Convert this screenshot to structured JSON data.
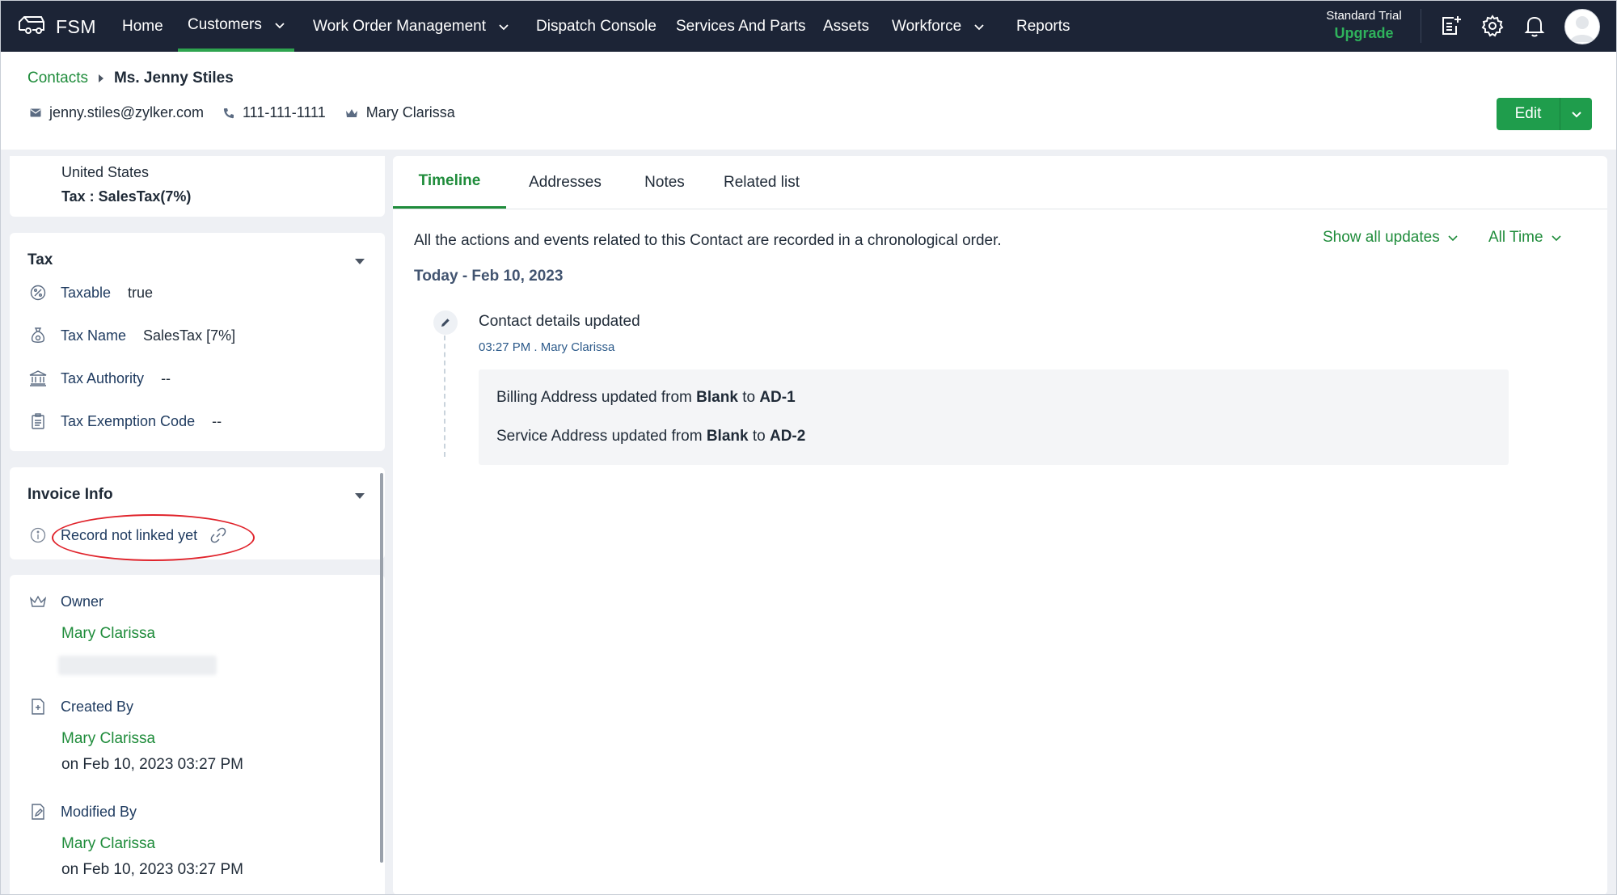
{
  "app": {
    "brand": "FSM",
    "nav": [
      {
        "label": "Home"
      },
      {
        "label": "Customers"
      },
      {
        "label": "Work Order Management"
      },
      {
        "label": "Dispatch Console"
      },
      {
        "label": "Services And Parts"
      },
      {
        "label": "Assets"
      },
      {
        "label": "Workforce"
      },
      {
        "label": "Reports"
      }
    ],
    "trial_label": "Standard Trial",
    "upgrade_label": "Upgrade",
    "accent": "#1f8c3b",
    "nav_bg": "#1c2436"
  },
  "header": {
    "breadcrumb_parent": "Contacts",
    "title": "Ms. Jenny Stiles",
    "email": "jenny.stiles@zylker.com",
    "phone": "111-111-1111",
    "owner": "Mary Clarissa",
    "edit_label": "Edit"
  },
  "left": {
    "address_country": "United States",
    "address_tax": "Tax : SalesTax(7%)",
    "tax": {
      "title": "Tax",
      "rows": [
        {
          "label": "Taxable",
          "value": "true"
        },
        {
          "label": "Tax Name",
          "value": "SalesTax [7%]"
        },
        {
          "label": "Tax Authority",
          "value": "--"
        },
        {
          "label": "Tax Exemption Code",
          "value": "--"
        }
      ]
    },
    "invoice": {
      "title": "Invoice Info",
      "status": "Record not linked yet"
    },
    "owner_section": {
      "owner_label": "Owner",
      "owner_name": "Mary Clarissa",
      "created_label": "Created By",
      "created_name": "Mary Clarissa",
      "created_on": "on Feb 10, 2023 03:27 PM",
      "modified_label": "Modified By",
      "modified_name": "Mary Clarissa",
      "modified_on": "on Feb 10, 2023 03:27 PM"
    }
  },
  "right": {
    "tabs": [
      {
        "label": "Timeline"
      },
      {
        "label": "Addresses"
      },
      {
        "label": "Notes"
      },
      {
        "label": "Related list"
      }
    ],
    "description": "All the actions and events related to this Contact are recorded in a chronological order.",
    "filter_updates": "Show all updates",
    "filter_time": "All Time",
    "date_group": "Today - Feb 10, 2023",
    "event": {
      "title": "Contact details updated",
      "meta": "03:27 PM . Mary Clarissa",
      "lines": [
        {
          "prefix": "Billing Address updated from",
          "from": "Blank",
          "mid": "to",
          "to": "AD-1"
        },
        {
          "prefix": "Service Address updated from",
          "from": "Blank",
          "mid": "to",
          "to": "AD-2"
        }
      ]
    }
  }
}
